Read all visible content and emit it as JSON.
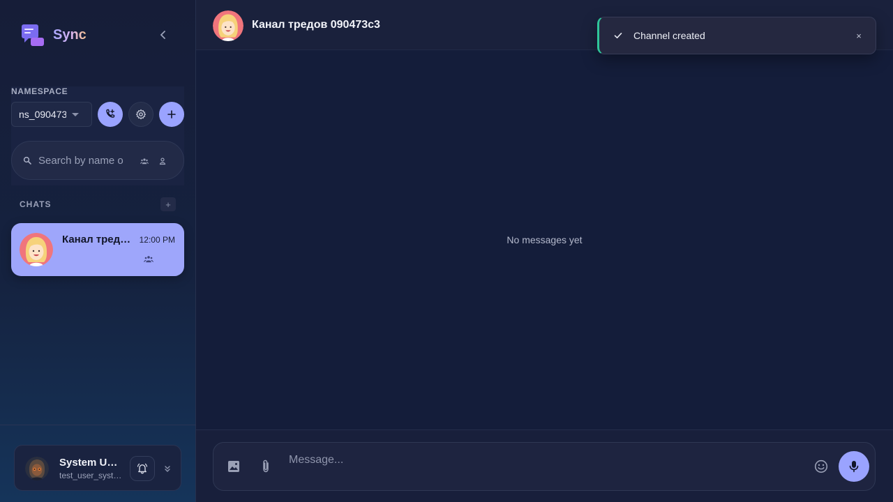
{
  "app": {
    "name": "Sync"
  },
  "sidebar": {
    "namespace_label": "NAMESPACE",
    "namespace_value": "ns_090473",
    "search_placeholder": "Search by name o",
    "chats_label": "CHATS",
    "chats_add": "+",
    "chats": [
      {
        "title": "Канал тредов 090473c3",
        "time": "12:00 PM"
      }
    ],
    "user": {
      "name": "System User",
      "handle": "test_user_system"
    }
  },
  "main": {
    "header_title": "Канал тредов 090473c3",
    "empty_text": "No messages yet",
    "composer_placeholder": "Message..."
  },
  "toast": {
    "text": "Channel created",
    "close": "×"
  },
  "colors": {
    "accent": "#9aa3ff",
    "success": "#2fc59a",
    "background": "#141d3a"
  }
}
